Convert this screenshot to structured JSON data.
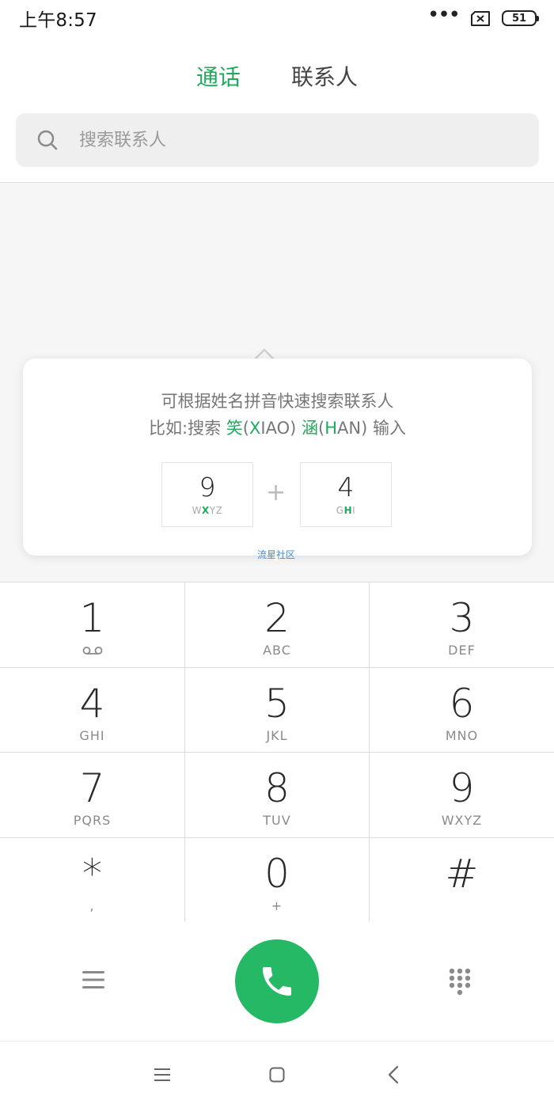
{
  "status_bar": {
    "time": "上午8:57",
    "dots": "•••",
    "battery": "51"
  },
  "tabs": [
    {
      "label": "通话",
      "active": true
    },
    {
      "label": "联系人",
      "active": false
    }
  ],
  "search": {
    "placeholder": "搜索联系人"
  },
  "tip": {
    "line1": "可根据姓名拼音快速搜索联系人",
    "line2_prefix": "比如:搜索 ",
    "word1": {
      "char": "笑",
      "open": "(",
      "initial": "X",
      "rest": "IAO)"
    },
    "word2": {
      "char": "涵",
      "open": "(",
      "initial": "H",
      "rest": "AN)"
    },
    "line2_suffix": " 输入",
    "example_keys": [
      {
        "digit": "9",
        "pre": "W",
        "hl": "X",
        "post": "YZ"
      },
      {
        "digit": "4",
        "pre": "G",
        "hl": "H",
        "post": "I"
      }
    ],
    "plus": "+"
  },
  "watermark": "流星社区",
  "keypad": [
    {
      "digit": "1",
      "sub": ""
    },
    {
      "digit": "2",
      "sub": "ABC"
    },
    {
      "digit": "3",
      "sub": "DEF"
    },
    {
      "digit": "4",
      "sub": "GHI"
    },
    {
      "digit": "5",
      "sub": "JKL"
    },
    {
      "digit": "6",
      "sub": "MNO"
    },
    {
      "digit": "7",
      "sub": "PQRS"
    },
    {
      "digit": "8",
      "sub": "TUV"
    },
    {
      "digit": "9",
      "sub": "WXYZ"
    },
    {
      "digit": "*",
      "sub": ","
    },
    {
      "digit": "0",
      "sub": "+"
    },
    {
      "digit": "#",
      "sub": ""
    }
  ],
  "colors": {
    "accent": "#1faa5d",
    "call_button": "#25b865"
  }
}
